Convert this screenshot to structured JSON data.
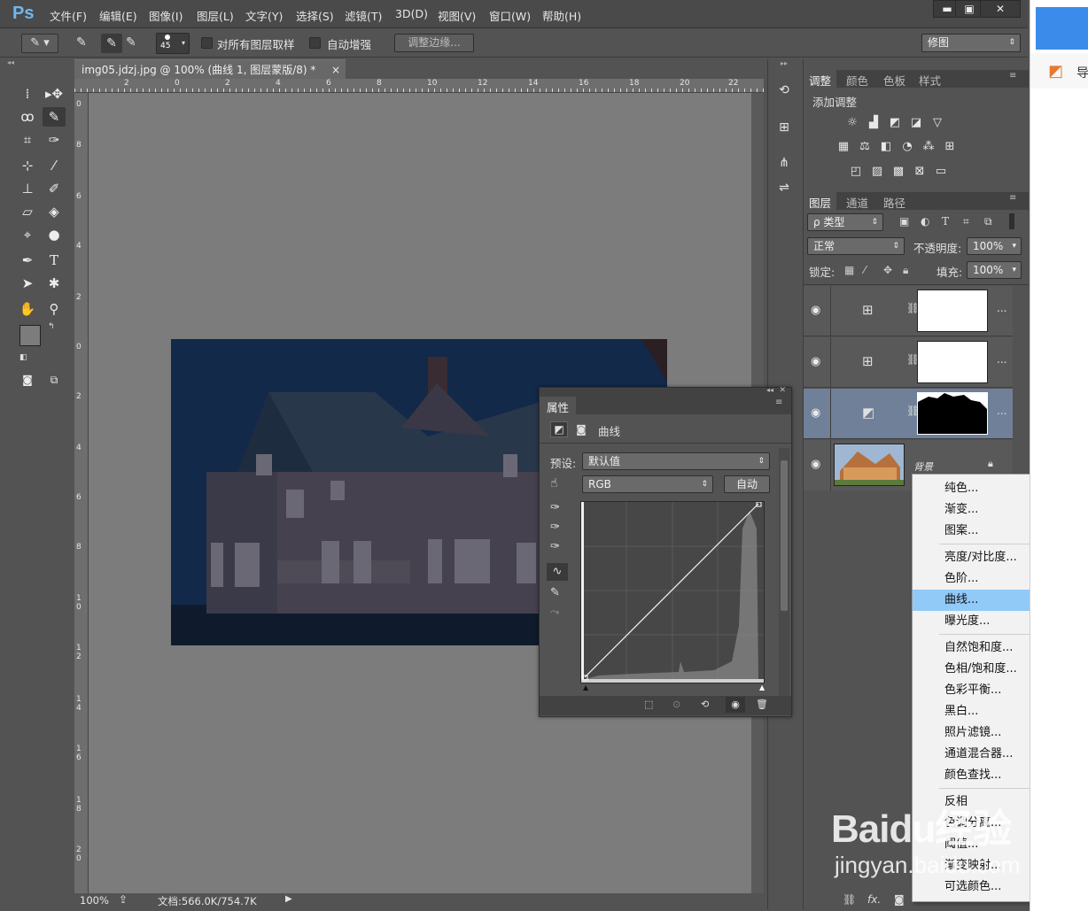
{
  "app": {
    "logo": "Ps"
  },
  "menu": [
    "文件(F)",
    "编辑(E)",
    "图像(I)",
    "图层(L)",
    "文字(Y)",
    "选择(S)",
    "滤镜(T)",
    "3D(D)",
    "视图(V)",
    "窗口(W)",
    "帮助(H)"
  ],
  "window_controls": {
    "minimize": "▬",
    "maximize": "▣",
    "close": "✕"
  },
  "options": {
    "brush_size": "45",
    "sample_all_layers": "对所有图层取样",
    "auto_enhance": "自动增强",
    "refine_edge": "调整边缘...",
    "workspace": "修图"
  },
  "document": {
    "tab_title": "img05.jdzj.jpg @ 100% (曲线 1, 图层蒙版/8) *",
    "close": "×",
    "zoom": "100%",
    "doc_size": "文档:566.0K/754.7K",
    "ruler_h": [
      "2",
      "0",
      "2",
      "4",
      "6",
      "8",
      "10",
      "12",
      "14",
      "16",
      "18",
      "20",
      "22"
    ],
    "ruler_v": [
      "0",
      "8",
      "6",
      "4",
      "2",
      "0",
      "2",
      "4",
      "6",
      "8",
      "1 0",
      "1 2",
      "1 4",
      "1 6",
      "1 8",
      "2 0"
    ]
  },
  "adjustments_panel": {
    "tabs": [
      "调整",
      "颜色",
      "色板",
      "样式"
    ],
    "title": "添加调整"
  },
  "layers_panel": {
    "tabs": [
      "图层",
      "通道",
      "路径"
    ],
    "filter": "ρ 类型",
    "blend_mode": "正常",
    "opacity_label": "不透明度:",
    "opacity": "100%",
    "lock_label": "锁定:",
    "fill_label": "填充:",
    "fill": "100%",
    "layers": [
      {
        "type": "grid",
        "selected": false
      },
      {
        "type": "grid",
        "selected": false
      },
      {
        "type": "curves",
        "selected": true
      },
      {
        "type": "background",
        "name": "背景",
        "selected": false
      }
    ],
    "more": "..."
  },
  "properties": {
    "tab": "属性",
    "type_label": "曲线",
    "preset_label": "预设:",
    "preset_value": "默认值",
    "channel": "RGB",
    "auto_button": "自动"
  },
  "context_menu": {
    "groups": [
      [
        "纯色...",
        "渐变...",
        "图案..."
      ],
      [
        "亮度/对比度...",
        "色阶...",
        "曲线...",
        "曝光度..."
      ],
      [
        "自然饱和度...",
        "色相/饱和度...",
        "色彩平衡...",
        "黑白...",
        "照片滤镜...",
        "通道混合器...",
        "颜色查找..."
      ],
      [
        "反相",
        "色调分离...",
        "阈值...",
        "渐变映射...",
        "可选颜色..."
      ]
    ],
    "highlighted": "曲线..."
  },
  "browser": {
    "partial_text": "导"
  },
  "watermark": {
    "line1": "Baidu经验",
    "line2": "jingyan.baidu.com"
  },
  "colors": {
    "menu_highlight": "#91c9f7",
    "selected_layer": "#6f8098",
    "ps_blue": "#6fb7f0",
    "browser_accent": "#3b8beb"
  }
}
